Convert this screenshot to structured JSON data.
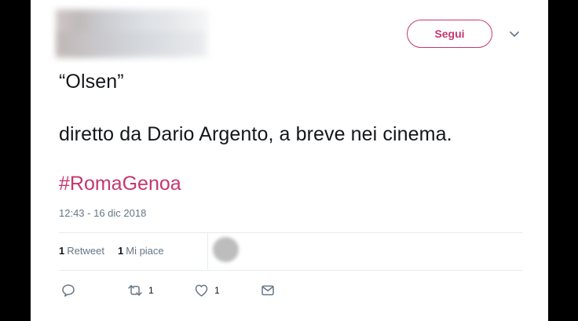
{
  "follow_label": "Segui",
  "tweet": {
    "line1": "“Olsen”",
    "line2": "diretto da Dario Argento, a breve nei cinema.",
    "hashtag": "#RomaGenoa",
    "timestamp": "12:43 - 16 dic 2018"
  },
  "stats": {
    "retweets_count": "1",
    "retweets_label": "Retweet",
    "likes_count": "1",
    "likes_label": "Mi piace"
  },
  "actions": {
    "retweet_count": "1",
    "like_count": "1"
  },
  "icons": {
    "reply": "reply-icon",
    "retweet": "retweet-icon",
    "like": "heart-icon",
    "message": "envelope-icon",
    "menu": "chevron-down-icon"
  },
  "colors": {
    "accent": "#c7366f",
    "text": "#14171a",
    "muted": "#657786"
  }
}
